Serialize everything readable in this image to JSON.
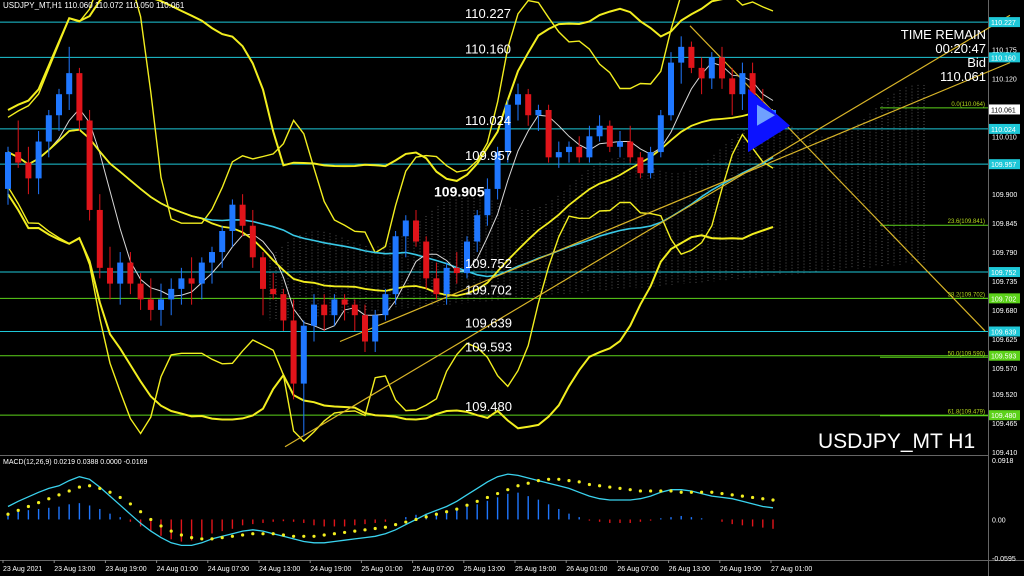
{
  "header": {
    "text": "USDJPY_MT,H1  110.060 110.072 110.050 110.061"
  },
  "timer": {
    "line1": "TIME REMAIN",
    "line2": "00:20:47",
    "line3": "Bid",
    "line4": "110.061"
  },
  "symbol_label": "USDJPY_MT H1",
  "macd_header": "MACD(12,26,9) 0.0219 0.0388 0.0000 -0.0169",
  "colors": {
    "background": "#000000",
    "bull": "#1f77ff",
    "bear": "#e0141a",
    "bollinger": "#f2ee1f",
    "trendline": "#d8b428",
    "level_cyan": "#1ec8d8",
    "level_green": "#5cd21a",
    "ma_white": "#d8d8d8",
    "ma_cyan": "#38c8e6",
    "macd_signal": "#f2ee1f",
    "macd_line": "#3ad2ee",
    "triangle": "#0c12ff",
    "fib_label": "#b4d81c"
  },
  "chart_data": [
    {
      "type": "candlestick",
      "title": "USDJPY_MT H1",
      "ylim": [
        109.41,
        110.25
      ],
      "x_tick_labels": [
        "23 Aug 2021",
        "23 Aug 13:00",
        "23 Aug 19:00",
        "24 Aug 01:00",
        "24 Aug 07:00",
        "24 Aug 13:00",
        "24 Aug 19:00",
        "25 Aug 01:00",
        "25 Aug 07:00",
        "25 Aug 13:00",
        "25 Aug 19:00",
        "26 Aug 01:00",
        "26 Aug 07:00",
        "26 Aug 13:00",
        "26 Aug 19:00",
        "27 Aug 01:00"
      ],
      "y_tick_labels": [
        "110.175",
        "110.120",
        "110.010",
        "109.900",
        "109.845",
        "109.790",
        "109.735",
        "109.680",
        "109.625",
        "109.570",
        "109.520",
        "109.465",
        "109.410"
      ],
      "price_box_labels": [
        "110.227",
        "110.160",
        "110.061",
        "110.024",
        "109.957",
        "109.752",
        "109.702",
        "109.639",
        "109.593",
        "109.480"
      ],
      "levels": [
        {
          "value": 110.227,
          "label": "110.227",
          "color": "cyan"
        },
        {
          "value": 110.16,
          "label": "110.160",
          "color": "cyan"
        },
        {
          "value": 110.024,
          "label": "110.024",
          "color": "cyan"
        },
        {
          "value": 109.957,
          "label": "109.957",
          "color": "cyan"
        },
        {
          "value": 109.752,
          "label": "109.752",
          "color": "cyan"
        },
        {
          "value": 109.702,
          "label": "109.702",
          "color": "green"
        },
        {
          "value": 109.639,
          "label": "109.639",
          "color": "cyan"
        },
        {
          "value": 109.593,
          "label": "109.593",
          "color": "green"
        },
        {
          "value": 109.48,
          "label": "109.480",
          "color": "green"
        }
      ],
      "annotation": "109.905",
      "fib_labels": [
        "0.0(110.064)",
        "23.6(109.841)",
        "38.2(109.702)",
        "50.0(109.590)",
        "61.8(109.479)"
      ],
      "ohlc": [
        [
          109.91,
          109.99,
          109.88,
          109.98
        ],
        [
          109.98,
          110.04,
          109.95,
          109.96
        ],
        [
          109.96,
          109.99,
          109.9,
          109.93
        ],
        [
          109.93,
          110.02,
          109.9,
          110.0
        ],
        [
          110.0,
          110.06,
          109.97,
          110.05
        ],
        [
          110.05,
          110.1,
          110.02,
          110.09
        ],
        [
          110.09,
          110.18,
          110.06,
          110.13
        ],
        [
          110.13,
          110.14,
          110.02,
          110.04
        ],
        [
          110.04,
          110.06,
          109.85,
          109.87
        ],
        [
          109.87,
          109.9,
          109.74,
          109.76
        ],
        [
          109.76,
          109.8,
          109.7,
          109.73
        ],
        [
          109.73,
          109.79,
          109.69,
          109.77
        ],
        [
          109.77,
          109.79,
          109.71,
          109.73
        ],
        [
          109.73,
          109.75,
          109.68,
          109.7
        ],
        [
          109.7,
          109.74,
          109.66,
          109.68
        ],
        [
          109.68,
          109.73,
          109.65,
          109.7
        ],
        [
          109.7,
          109.74,
          109.67,
          109.72
        ],
        [
          109.72,
          109.76,
          109.69,
          109.74
        ],
        [
          109.74,
          109.78,
          109.69,
          109.73
        ],
        [
          109.73,
          109.78,
          109.7,
          109.77
        ],
        [
          109.77,
          109.8,
          109.73,
          109.79
        ],
        [
          109.79,
          109.84,
          109.76,
          109.83
        ],
        [
          109.83,
          109.89,
          109.8,
          109.88
        ],
        [
          109.88,
          109.9,
          109.82,
          109.84
        ],
        [
          109.84,
          109.87,
          109.76,
          109.78
        ],
        [
          109.78,
          109.79,
          109.67,
          109.72
        ],
        [
          109.72,
          109.75,
          109.7,
          109.71
        ],
        [
          109.71,
          109.72,
          109.64,
          109.66
        ],
        [
          109.66,
          109.7,
          109.51,
          109.54
        ],
        [
          109.54,
          109.66,
          109.44,
          109.65
        ],
        [
          109.65,
          109.71,
          109.62,
          109.69
        ],
        [
          109.69,
          109.71,
          109.64,
          109.67
        ],
        [
          109.67,
          109.71,
          109.65,
          109.7
        ],
        [
          109.7,
          109.71,
          109.66,
          109.69
        ],
        [
          109.69,
          109.7,
          109.64,
          109.67
        ],
        [
          109.67,
          109.69,
          109.6,
          109.62
        ],
        [
          109.62,
          109.68,
          109.6,
          109.67
        ],
        [
          109.67,
          109.72,
          109.66,
          109.71
        ],
        [
          109.71,
          109.83,
          109.69,
          109.82
        ],
        [
          109.82,
          109.86,
          109.78,
          109.85
        ],
        [
          109.85,
          109.87,
          109.8,
          109.81
        ],
        [
          109.81,
          109.82,
          109.72,
          109.74
        ],
        [
          109.74,
          109.77,
          109.7,
          109.71
        ],
        [
          109.71,
          109.77,
          109.69,
          109.76
        ],
        [
          109.76,
          109.79,
          109.73,
          109.75
        ],
        [
          109.75,
          109.82,
          109.74,
          109.81
        ],
        [
          109.81,
          109.87,
          109.79,
          109.86
        ],
        [
          109.86,
          109.93,
          109.84,
          109.91
        ],
        [
          109.91,
          109.99,
          109.89,
          109.98
        ],
        [
          109.98,
          110.08,
          109.96,
          110.07
        ],
        [
          110.07,
          110.11,
          110.04,
          110.09
        ],
        [
          110.09,
          110.1,
          110.03,
          110.05
        ],
        [
          110.05,
          110.07,
          110.02,
          110.06
        ],
        [
          110.06,
          110.07,
          109.96,
          109.97
        ],
        [
          109.97,
          110.0,
          109.95,
          109.98
        ],
        [
          109.98,
          110.0,
          109.96,
          109.99
        ],
        [
          109.99,
          110.01,
          109.96,
          109.97
        ],
        [
          109.97,
          110.03,
          109.96,
          110.01
        ],
        [
          110.01,
          110.05,
          110.0,
          110.03
        ],
        [
          110.03,
          110.04,
          109.98,
          109.99
        ],
        [
          109.99,
          110.02,
          109.97,
          110.0
        ],
        [
          110.0,
          110.03,
          109.96,
          109.97
        ],
        [
          109.97,
          109.98,
          109.93,
          109.94
        ],
        [
          109.94,
          109.99,
          109.93,
          109.98
        ],
        [
          109.98,
          110.06,
          109.97,
          110.05
        ],
        [
          110.05,
          110.17,
          110.04,
          110.15
        ],
        [
          110.15,
          110.2,
          110.11,
          110.18
        ],
        [
          110.18,
          110.19,
          110.13,
          110.14
        ],
        [
          110.14,
          110.16,
          110.09,
          110.12
        ],
        [
          110.12,
          110.17,
          110.1,
          110.16
        ],
        [
          110.16,
          110.18,
          110.1,
          110.12
        ],
        [
          110.12,
          110.14,
          110.05,
          110.09
        ],
        [
          110.09,
          110.15,
          110.06,
          110.13
        ],
        [
          110.13,
          110.15,
          110.05,
          110.07
        ],
        [
          110.07,
          110.1,
          110.02,
          110.04
        ],
        [
          110.04,
          110.06,
          110.01,
          110.06
        ]
      ],
      "series": [
        {
          "name": "Bollinger upper",
          "values": []
        },
        {
          "name": "Bollinger lower",
          "values": []
        }
      ]
    },
    {
      "type": "bar",
      "title": "MACD(12,26,9)",
      "y_tick_labels": [
        "0.0918",
        "0.00",
        "-0.0595"
      ],
      "ylim": [
        -0.0595,
        0.0918
      ],
      "histogram": [
        0.012,
        0.014,
        0.016,
        0.018,
        0.02,
        0.022,
        0.026,
        0.028,
        0.024,
        0.018,
        0.01,
        0.004,
        -0.004,
        -0.012,
        -0.02,
        -0.028,
        -0.034,
        -0.038,
        -0.036,
        -0.03,
        -0.024,
        -0.02,
        -0.016,
        -0.01,
        -0.008,
        -0.006,
        -0.004,
        -0.003,
        -0.004,
        -0.006,
        -0.01,
        -0.012,
        -0.012,
        -0.012,
        -0.01,
        -0.008,
        -0.006,
        -0.004,
        0.0,
        0.004,
        0.008,
        0.01,
        0.012,
        0.014,
        0.018,
        0.022,
        0.026,
        0.032,
        0.038,
        0.044,
        0.046,
        0.04,
        0.034,
        0.026,
        0.018,
        0.01,
        0.004,
        -0.002,
        -0.004,
        -0.006,
        -0.006,
        -0.006,
        -0.004,
        -0.002,
        0.002,
        0.004,
        0.006,
        0.004,
        0.002,
        0.0,
        -0.004,
        -0.008,
        -0.01,
        -0.012,
        -0.014,
        -0.016
      ],
      "macd_line": [
        0.02,
        0.028,
        0.035,
        0.042,
        0.048,
        0.052,
        0.06,
        0.066,
        0.062,
        0.05,
        0.036,
        0.022,
        0.008,
        -0.006,
        -0.018,
        -0.028,
        -0.036,
        -0.04,
        -0.04,
        -0.036,
        -0.03,
        -0.026,
        -0.022,
        -0.018,
        -0.016,
        -0.018,
        -0.022,
        -0.026,
        -0.03,
        -0.034,
        -0.036,
        -0.036,
        -0.034,
        -0.032,
        -0.03,
        -0.028,
        -0.026,
        -0.022,
        -0.016,
        -0.008,
        0.0,
        0.008,
        0.014,
        0.02,
        0.028,
        0.038,
        0.048,
        0.058,
        0.066,
        0.07,
        0.068,
        0.064,
        0.06,
        0.056,
        0.052,
        0.048,
        0.042,
        0.036,
        0.032,
        0.03,
        0.03,
        0.03,
        0.032,
        0.036,
        0.042,
        0.046,
        0.046,
        0.044,
        0.04,
        0.036,
        0.034,
        0.032,
        0.028,
        0.024,
        0.02,
        0.018
      ],
      "signal_line": [
        0.008,
        0.014,
        0.02,
        0.026,
        0.032,
        0.038,
        0.044,
        0.05,
        0.052,
        0.048,
        0.042,
        0.034,
        0.024,
        0.012,
        0.0,
        -0.01,
        -0.018,
        -0.024,
        -0.028,
        -0.03,
        -0.03,
        -0.028,
        -0.026,
        -0.024,
        -0.022,
        -0.022,
        -0.022,
        -0.024,
        -0.026,
        -0.026,
        -0.026,
        -0.024,
        -0.022,
        -0.02,
        -0.018,
        -0.016,
        -0.014,
        -0.012,
        -0.008,
        -0.004,
        0.0,
        0.004,
        0.008,
        0.012,
        0.016,
        0.022,
        0.028,
        0.034,
        0.04,
        0.046,
        0.052,
        0.056,
        0.06,
        0.062,
        0.062,
        0.06,
        0.058,
        0.054,
        0.052,
        0.05,
        0.048,
        0.046,
        0.044,
        0.044,
        0.044,
        0.044,
        0.042,
        0.042,
        0.042,
        0.042,
        0.04,
        0.038,
        0.036,
        0.034,
        0.032,
        0.03
      ]
    }
  ]
}
